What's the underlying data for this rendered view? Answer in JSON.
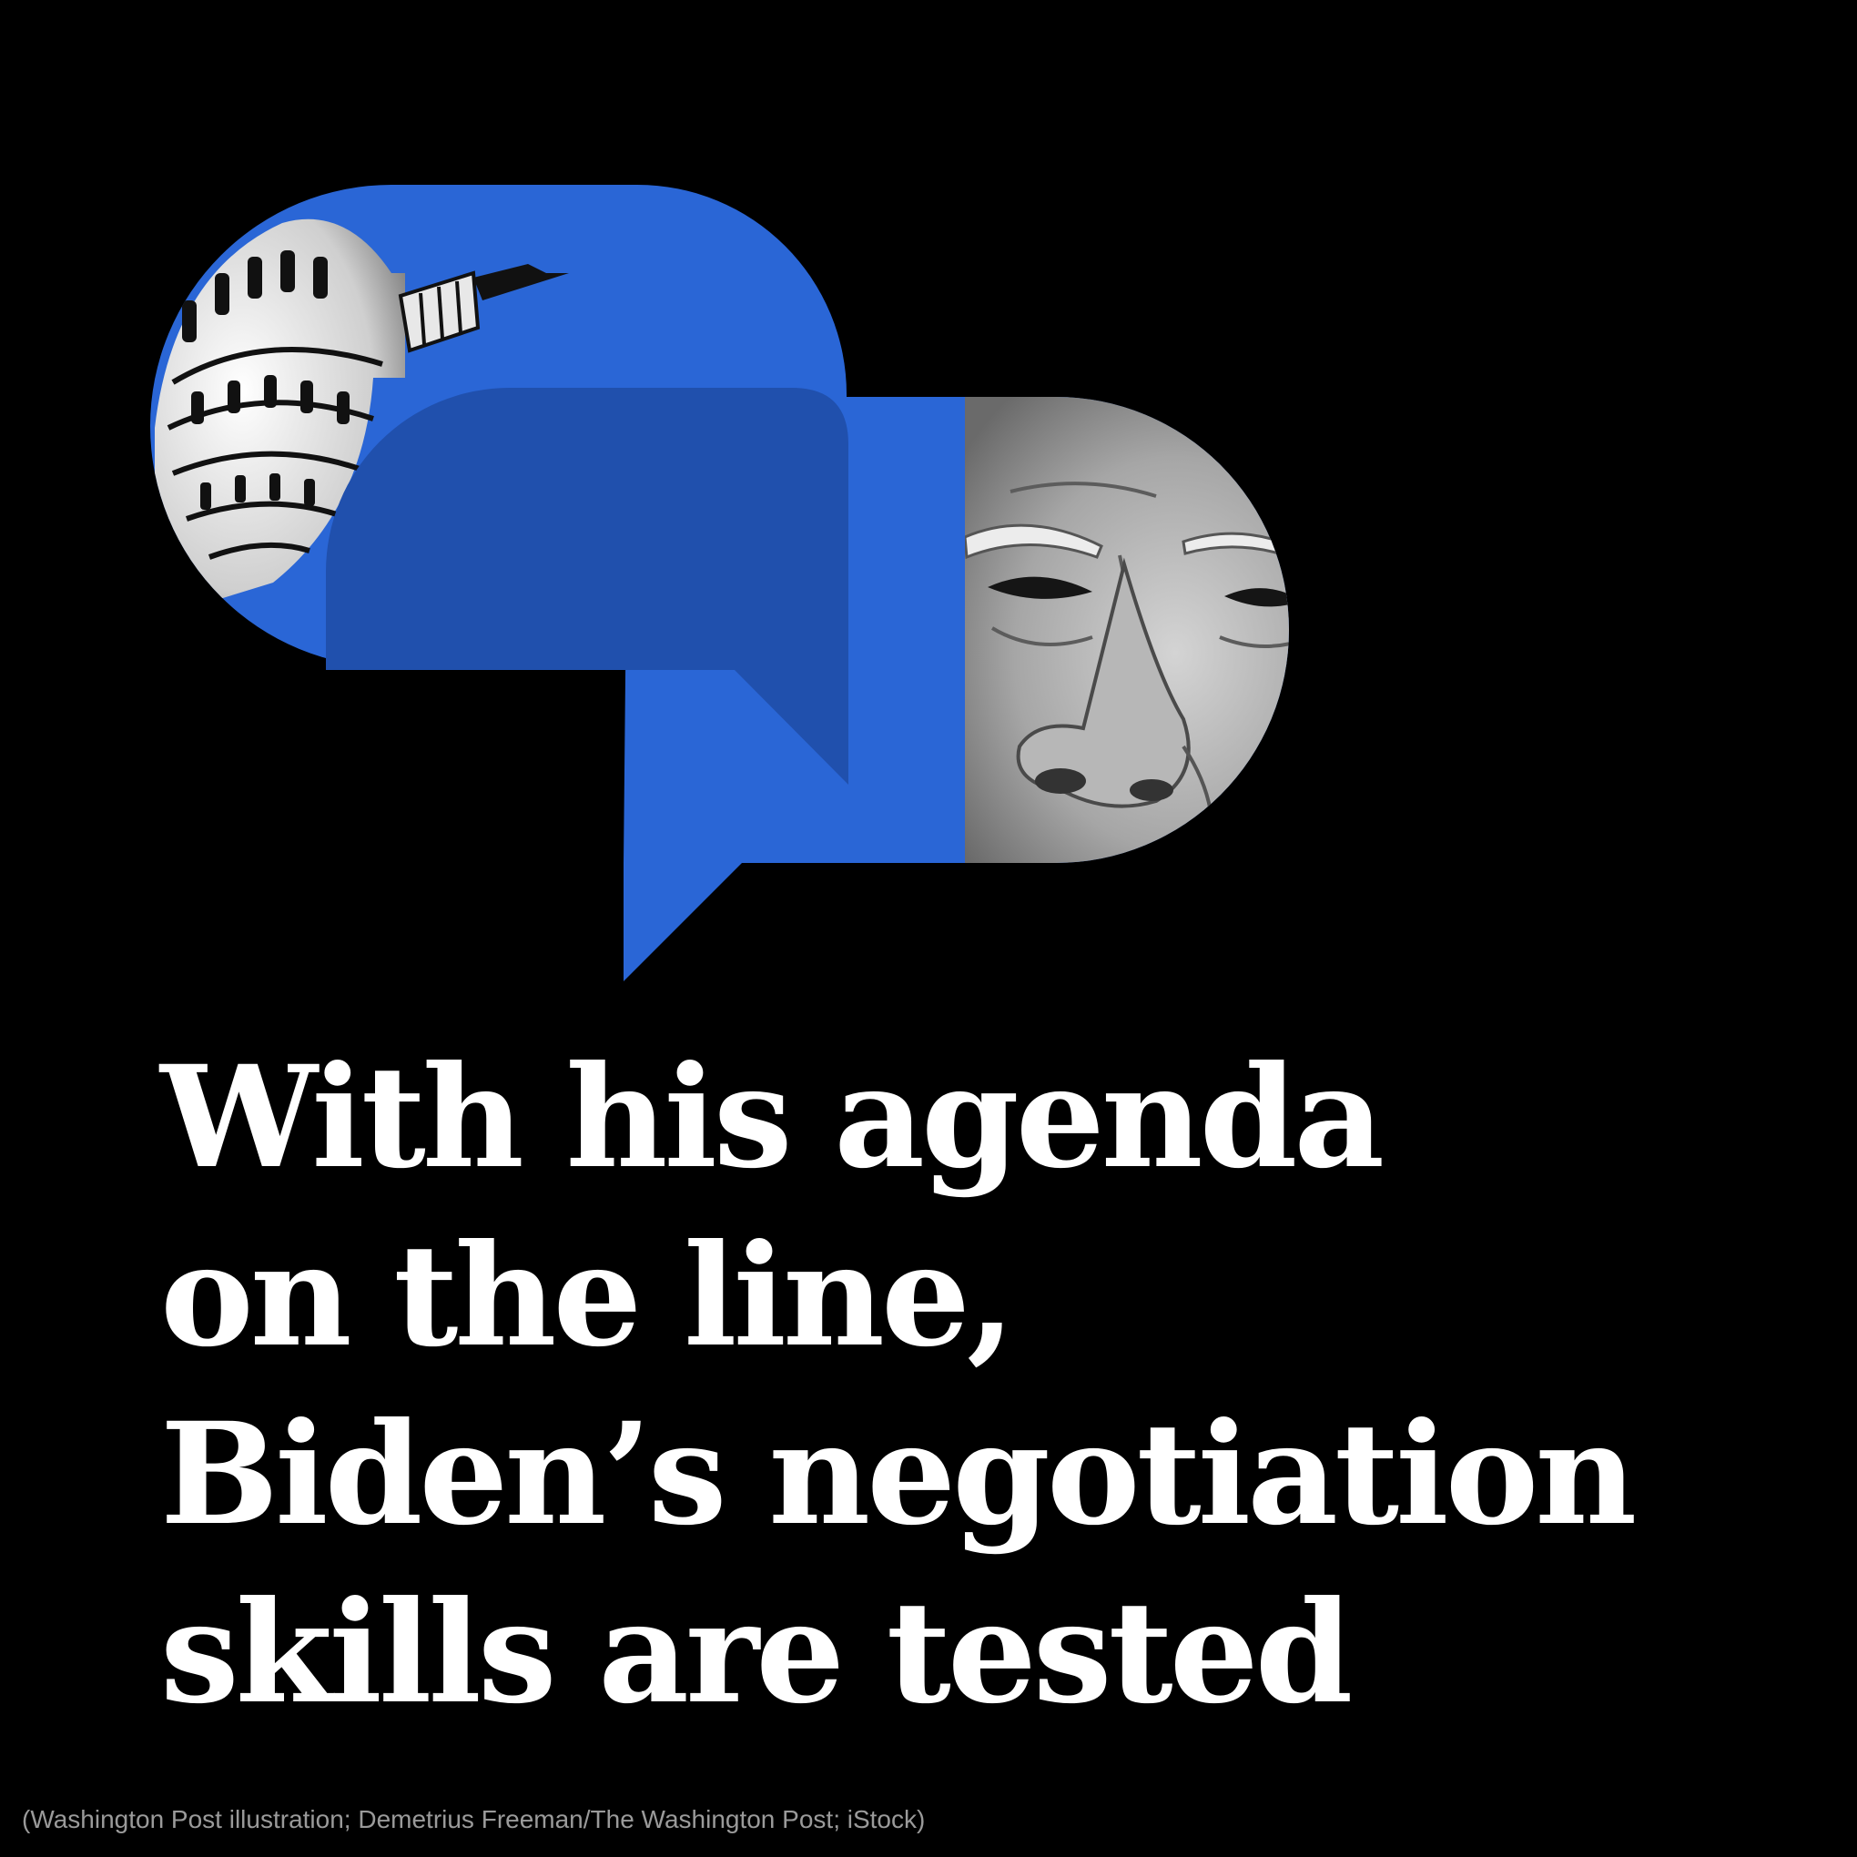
{
  "headline": {
    "line1": "With his agenda",
    "line2": "on the line,",
    "line3": "Biden’s negotiation",
    "line4": "skills are tested"
  },
  "credit": "(Washington Post illustration; Demetrius Freeman/The Washington Post; iStock)",
  "colors": {
    "background": "#000000",
    "bubble_blue": "#2a66d6",
    "bubble_overlap": "#2050ad",
    "headline": "#ffffff",
    "credit": "#9a9a9a"
  },
  "illustration": {
    "left_bubble_image": "capitol-dome-icon",
    "right_bubble_image": "face-closeup-icon"
  }
}
